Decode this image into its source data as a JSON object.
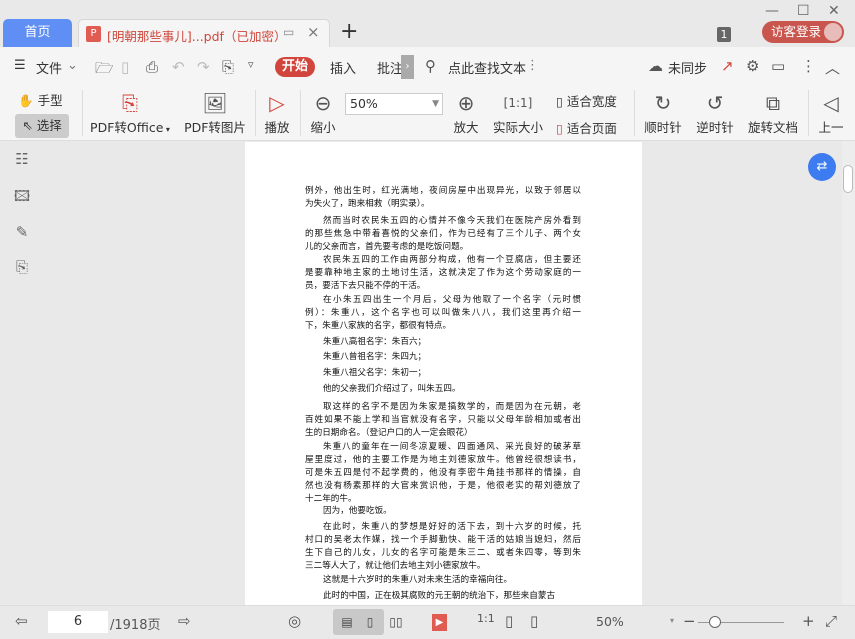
{
  "tabs": {
    "home": "首页",
    "doc_title": "[明朝那些事儿]...pdf（已加密）",
    "doc_icon": "pdf-icon",
    "new_tab": "+"
  },
  "window": {
    "minimize": "—",
    "maximize": "☐",
    "close": "✕",
    "tab_count": "1",
    "login": "访客登录"
  },
  "menu": {
    "file": "文件",
    "items": [
      "开始",
      "插入",
      "批注"
    ],
    "search_placeholder": "点此查找文本",
    "sync": "未同步"
  },
  "ribbon": {
    "hand": "手型",
    "select": "选择",
    "pdf_to_office": "PDF转Office",
    "pdf_to_image": "PDF转图片",
    "play": "播放",
    "zoom_out": "缩小",
    "zoom_value": "50%",
    "zoom_in": "放大",
    "actual_size": "实际大小",
    "fit_width": "适合宽度",
    "fit_page": "适合页面",
    "clockwise": "顺时针",
    "counterclockwise": "逆时针",
    "rotate_doc": "旋转文档",
    "prev": "上一"
  },
  "document": {
    "paragraphs": [
      {
        "indent": false,
        "lines": [
          "例外，他出生时，红光满地，夜间房屋中出现异光，以致于邻居以",
          "为失火了，跑来相救（明实录）。"
        ]
      },
      {
        "indent": true,
        "lines": [
          "然而当时农民朱五四的心情并不像今天我们在医院产房外看到",
          "的那些焦急中带着喜悦的父亲们，作为已经有了三个儿子、两个女",
          "儿的父亲而言，首先要考虑的是吃饭问题。"
        ]
      },
      {
        "indent": true,
        "lines": [
          "农民朱五四的工作由两部分构成，他有一个豆腐店，但主要还",
          "是要靠种地主家的土地讨生活，这就决定了作为这个劳动家庭的一",
          "员，要活下去只能不停的干活。"
        ]
      },
      {
        "indent": true,
        "lines": [
          "在小朱五四出生一个月后，父母为他取了一个名字（元时惯",
          "例）：朱重八，这个名字也可以叫做朱八八，我们这里再介绍一",
          "下，朱重八家族的名字，都很有特点。"
        ]
      },
      {
        "indent": true,
        "lines": [
          "朱重八高祖名字：朱百六；"
        ]
      },
      {
        "indent": true,
        "lines": [
          "朱重八曾祖名字：朱四九；"
        ]
      },
      {
        "indent": true,
        "lines": [
          "朱重八祖父名字：朱初一；"
        ]
      },
      {
        "indent": true,
        "lines": [
          "他的父亲我们介绍过了，叫朱五四。"
        ]
      },
      {
        "indent": true,
        "lines": [
          "取这样的名字不是因为朱家是搞数学的，而是因为在元朝，老",
          "百姓如果不能上学和当官就没有名字，只能以父母年龄相加或者出",
          "生的日期命名。（登记户口的人一定会眼花）"
        ]
      },
      {
        "indent": true,
        "lines": [
          "朱重八的童年在一间冬凉夏暖、四面通风、采光良好的破茅草",
          "屋里度过，他的主要工作是为地主刘德家放牛。他曾经很想读书，",
          "可是朱五四是付不起学费的，他没有李密牛角挂书那样的情操，自",
          "然也没有杨素那样的大官来赏识他，于是，他很老实的帮刘德放了",
          "十二年的牛。"
        ]
      },
      {
        "indent": true,
        "lines": [
          "因为，他要吃饭。"
        ]
      },
      {
        "indent": true,
        "lines": [
          "在此时，朱重八的梦想是好好的活下去，到十六岁的时候，托",
          "村口的吴老太作媒，找一个手脚勤快、能干活的姑娘当媳妇，然后",
          "生下自己的儿女，儿女的名字可能是朱三二、或者朱四零，等到朱",
          "三二等人大了，就让他们去地主刘小德家放牛。"
        ]
      },
      {
        "indent": true,
        "lines": [
          "这就是十六岁时的朱重八对未来生活的幸福向往。"
        ]
      },
      {
        "indent": true,
        "lines": [
          "此时的中国，正在极其腐败的元王朝的统治下，那些来自蒙古"
        ]
      }
    ]
  },
  "status": {
    "current_page": "6",
    "total_pages": "/1918页",
    "zoom": "50%",
    "zoom_slider_fraction": 0.2
  },
  "colors": {
    "accent": "#d2453c",
    "home_tab": "#5f8ff5",
    "float_button": "#3d7cf0"
  }
}
